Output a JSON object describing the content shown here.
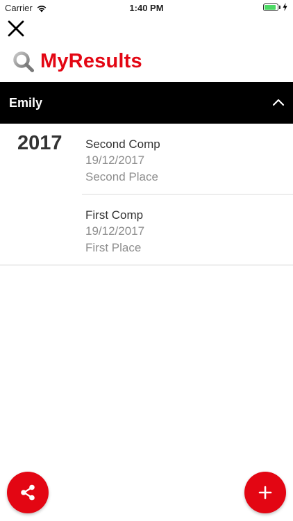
{
  "status_bar": {
    "carrier": "Carrier",
    "time": "1:40 PM",
    "battery_level": 0.9
  },
  "header": {
    "brand_title": "MyResults",
    "icons": {
      "close": "close-icon",
      "brand": "magnifier-icon"
    }
  },
  "section": {
    "name": "Emily",
    "expanded": true,
    "year": "2017",
    "results": [
      {
        "title": "Second Comp",
        "date": "19/12/2017",
        "place": "Second Place"
      },
      {
        "title": "First Comp",
        "date": "19/12/2017",
        "place": "First Place"
      }
    ]
  },
  "actions": {
    "share_icon": "share-icon",
    "add_icon": "plus-icon"
  },
  "colors": {
    "accent": "#e30613",
    "header_bg": "#000000",
    "secondary_text": "#8e8e8e",
    "battery": "#4cd964"
  }
}
